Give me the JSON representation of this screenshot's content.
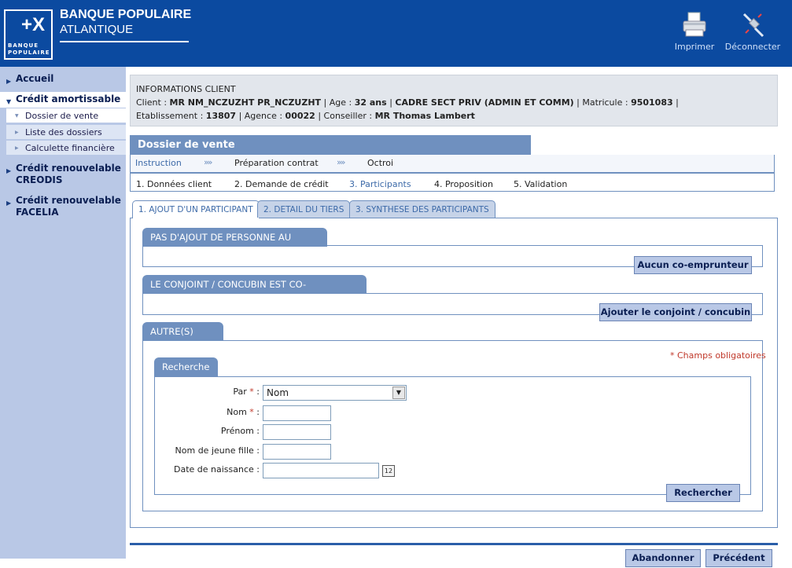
{
  "header": {
    "brand_line1": "BANQUE POPULAIRE",
    "brand_line2": "ATLANTIQUE",
    "logo_text": "BANQUE POPULAIRE",
    "print_label": "Imprimer",
    "logout_label": "Déconnecter"
  },
  "sidebar": {
    "accueil": "Accueil",
    "credit_amortissable": "Crédit amortissable",
    "dossier_vente": "Dossier de vente",
    "liste_dossiers": "Liste des dossiers",
    "calculette": "Calculette financière",
    "creodis_1": "Crédit renouvelable",
    "creodis_2": "CREODIS",
    "facelia_1": "Crédit renouvelable",
    "facelia_2": "FACELIA"
  },
  "info": {
    "title": "INFORMATIONS CLIENT",
    "client_label": "Client : ",
    "client_value": "MR NM_NCZUZHT PR_NCZUZHT",
    "age_label": " | Age : ",
    "age_value": "32 ans",
    "job_value": "CADRE SECT PRIV (ADMIN ET COMM)",
    "matricule_label": " | Matricule : ",
    "matricule_value": "9501083",
    "etab_label": "Etablissement : ",
    "etab_value": "13807",
    "agence_label": " | Agence : ",
    "agence_value": "00022",
    "conseiller_label": " | Conseiller : ",
    "conseiller_value": "MR Thomas Lambert"
  },
  "dossier": {
    "title": "Dossier de vente",
    "phases": [
      "Instruction",
      "Préparation contrat",
      "Octroi"
    ],
    "steps": [
      "1. Données client",
      "2. Demande de crédit",
      "3. Participants",
      "4. Proposition",
      "5. Validation"
    ]
  },
  "tabs": [
    "1. AJOUT D'UN PARTICIPANT",
    "2. DETAIL DU TIERS",
    "3. SYNTHESE DES PARTICIPANTS"
  ],
  "sections": {
    "no_person": "PAS D'AJOUT DE PERSONNE AU DOSSIER",
    "no_coborrower_btn": "Aucun co-emprunteur",
    "spouse": "LE CONJOINT / CONCUBIN EST CO-EMPRUNTEUR",
    "add_spouse_btn": "Ajouter le conjoint / concubin",
    "others": "AUTRE(S) TIERS",
    "required_note": "* Champs obligatoires",
    "search_title": "Recherche"
  },
  "form": {
    "par_label": "Par",
    "par_value": "Nom",
    "nom_label": "Nom",
    "prenom_label": "Prénom :",
    "jeune_fille_label": "Nom de jeune fille :",
    "naissance_label": "Date de naissance :",
    "calendar_day": "12",
    "search_btn": "Rechercher"
  },
  "footer": {
    "abandon_btn": "Abandonner",
    "prev_btn": "Précédent"
  }
}
